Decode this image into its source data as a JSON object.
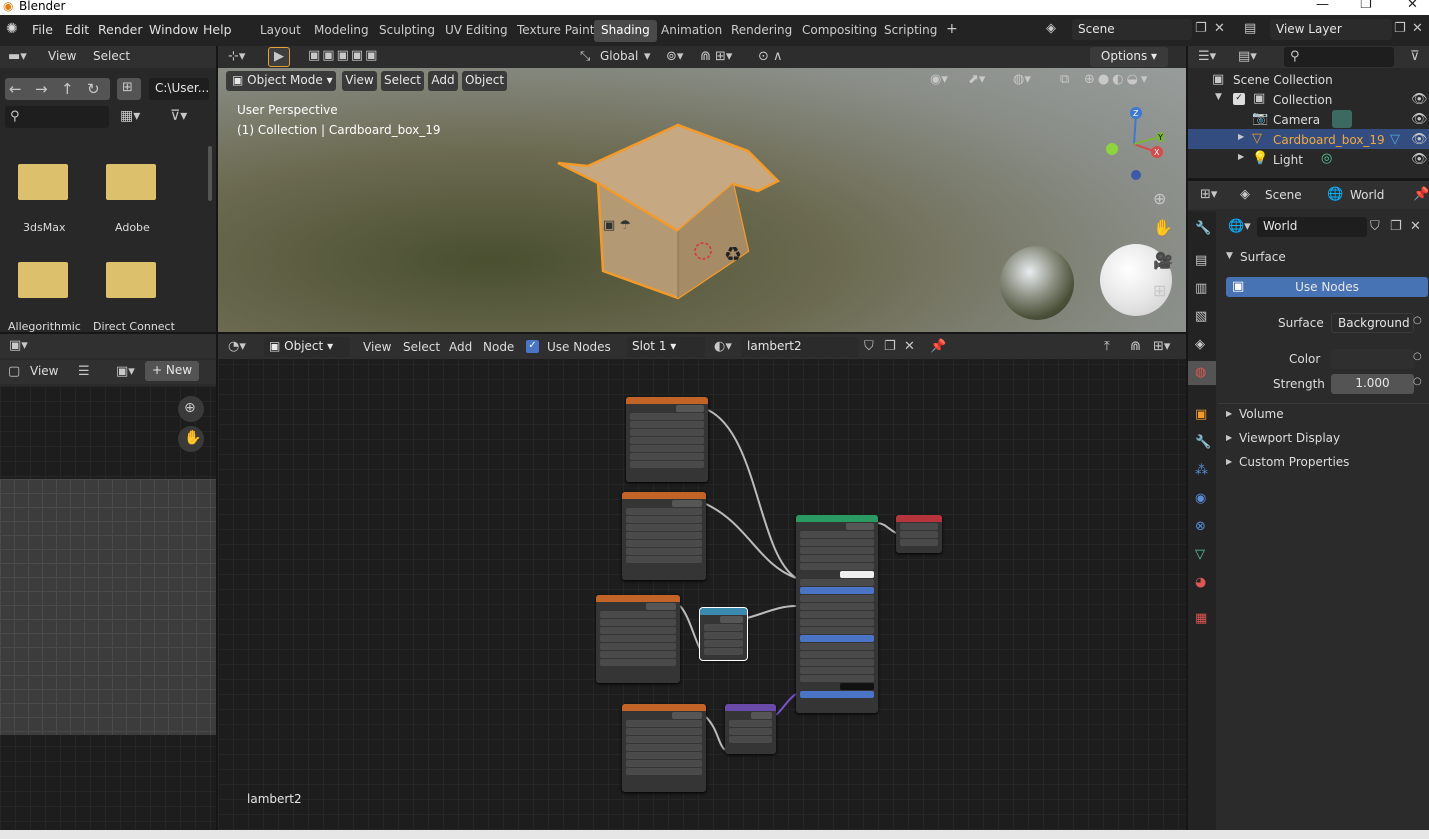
{
  "titlebar": {
    "app": "Blender"
  },
  "menu": [
    "File",
    "Edit",
    "Render",
    "Window",
    "Help"
  ],
  "workspaces": [
    "Layout",
    "Modeling",
    "Sculpting",
    "UV Editing",
    "Texture Paint",
    "Shading",
    "Animation",
    "Rendering",
    "Compositing",
    "Scripting"
  ],
  "active_workspace": "Shading",
  "scene": {
    "name": "Scene",
    "view_layer": "View Layer"
  },
  "file_browser": {
    "menu": [
      "View",
      "Select"
    ],
    "path": "C:\\User...",
    "folders": [
      "3dsMax",
      "Adobe",
      "Allegorithmic",
      "Direct Connect"
    ]
  },
  "viewport": {
    "mode": "Object Mode",
    "menu": [
      "View",
      "Select",
      "Add",
      "Object"
    ],
    "orientation": "Global",
    "options": "Options",
    "overlay1": "User Perspective",
    "overlay2": "(1) Collection | Cardboard_box_19"
  },
  "image_editor": {
    "view": "View",
    "new": "New"
  },
  "node_editor": {
    "type": "Object",
    "menu": [
      "View",
      "Select",
      "Add",
      "Node"
    ],
    "use_nodes": "Use Nodes",
    "slot": "Slot 1",
    "material": "lambert2",
    "footer": "lambert2"
  },
  "outliner": {
    "root": "Scene Collection",
    "collection": "Collection",
    "items": [
      "Camera",
      "Cardboard_box_19",
      "Light"
    ]
  },
  "properties": {
    "tabs": [
      "Scene",
      "World"
    ],
    "world": "World",
    "surface_panel": "Surface",
    "use_nodes": "Use Nodes",
    "surface_label": "Surface",
    "surface_value": "Background",
    "color_label": "Color",
    "strength_label": "Strength",
    "strength_value": "1.000",
    "panels": [
      "Volume",
      "Viewport Display",
      "Custom Properties"
    ]
  }
}
